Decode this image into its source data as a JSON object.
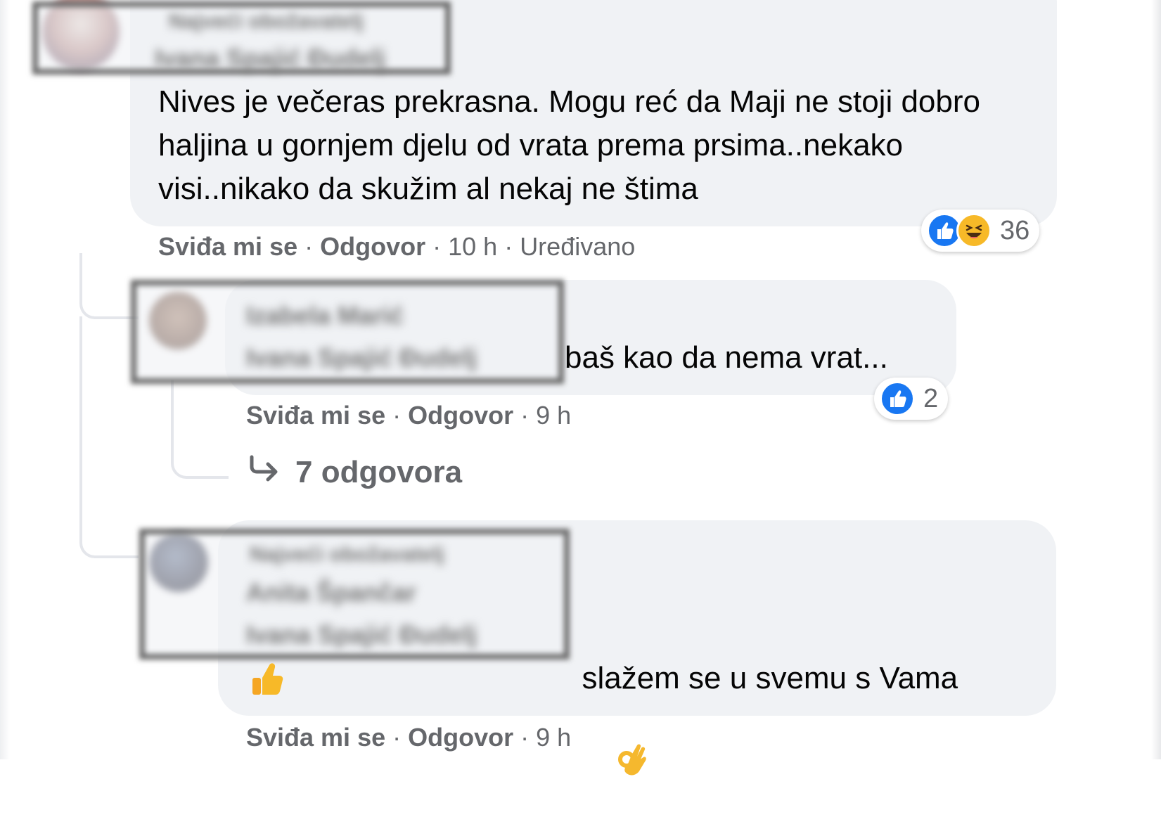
{
  "comments": [
    {
      "author_blurred": "Ivana Spajić Đudelj",
      "badge_blurred": "Najveći obožavatelj",
      "text": "Nives je večeras prekrasna. Mogu reć da Maji ne stoji dobro haljina u gornjem djelu od vrata prema prsima..nekako visi..nikako da skužim al nekaj ne štima",
      "like_label": "Sviđa mi se",
      "reply_label": "Odgovor",
      "time": "10 h",
      "edited": "Uređivano",
      "reaction_count": "36"
    },
    {
      "author_blurred": "Izabela Marić",
      "mention_blurred": "Ivana Spajić Đudelj",
      "text": "baš kao da nema vrat...",
      "like_label": "Sviđa mi se",
      "reply_label": "Odgovor",
      "time": "9 h",
      "reaction_count": "2",
      "replies_link": "7 odgovora"
    },
    {
      "badge_blurred": "Najveći obožavatelj",
      "author_blurred": "Anita Špančar",
      "mention_blurred": "Ivana Spajić Đudelj",
      "text": "slažem se u svemu s Vama",
      "like_label": "Sviđa mi se",
      "reply_label": "Odgovor",
      "time": "9 h"
    }
  ],
  "separator": "·",
  "icons": {
    "like": "thumbs-up-icon",
    "haha": "laughing-face-icon",
    "ok_hand": "ok-hand-emoji",
    "thumbs_up_emoji": "thumbs-up-emoji",
    "reply_arrow": "reply-arrow-icon"
  },
  "colors": {
    "bubble": "#f0f2f5",
    "meta_text": "#65676b",
    "like_blue": "#1877f2",
    "haha_yellow": "#f7b928"
  }
}
